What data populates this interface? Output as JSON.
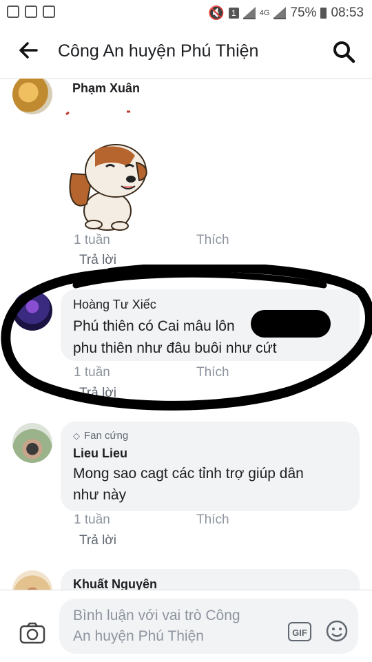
{
  "status_bar": {
    "battery": "75%",
    "time": "08:53",
    "network": "4G",
    "sim": "1"
  },
  "header": {
    "title": "Công An huyện Phú Thiện"
  },
  "comments": [
    {
      "name": "Phạm Xuân",
      "time": "1 tuần",
      "like": "Thích",
      "reply": "Trả lời"
    },
    {
      "name": "Hoàng Tư Xiếc",
      "text_line1": "Phú thiên có Cai mâu lôn",
      "text_line2": "phu thiên như đâu buôi như cứt",
      "time": "1 tuần",
      "like": "Thích",
      "reply": "Trả lời"
    },
    {
      "badge": "Fan cứng",
      "name": "Lieu Lieu",
      "text_line1": "Mong sao cagt các tỉnh trợ giúp dân",
      "text_line2": "như này",
      "time": "1 tuần",
      "like": "Thích",
      "reply": "Trả lời"
    },
    {
      "name": "Khuất Nguyên"
    }
  ],
  "composer": {
    "placeholder_line1": "Bình luận với vai trò Công",
    "placeholder_line2": "An huyện Phú Thiện",
    "gif_label": "GIF"
  },
  "colors": {
    "bubble": "#f2f3f5",
    "meta_text": "#8d949e",
    "marker_circle": "#000000"
  },
  "icons": [
    "back-arrow-icon",
    "search-icon",
    "camera-icon",
    "gif-icon",
    "emoji-icon",
    "diamond-icon"
  ]
}
